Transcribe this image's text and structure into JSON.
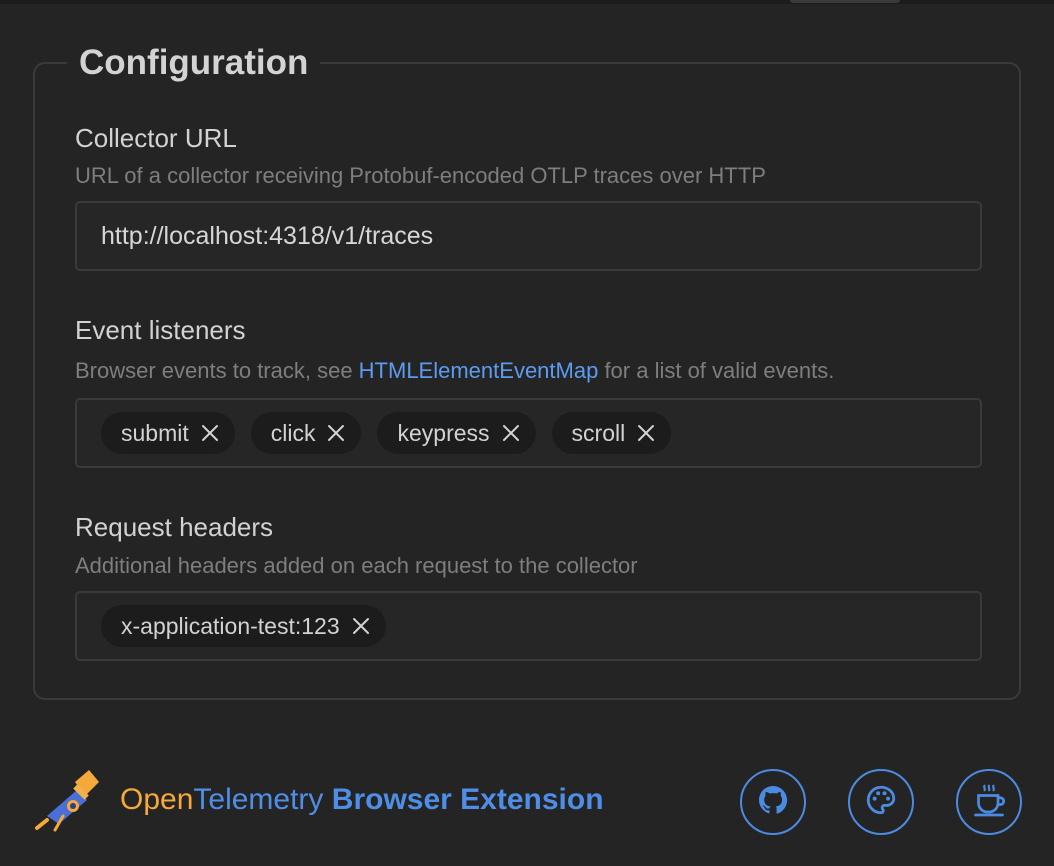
{
  "config": {
    "legend": "Configuration",
    "collector": {
      "label": "Collector URL",
      "description": "URL of a collector receiving Protobuf-encoded OTLP traces over HTTP",
      "value": "http://localhost:4318/v1/traces"
    },
    "events": {
      "label": "Event listeners",
      "description_before": "Browser events to track, see ",
      "description_link": "HTMLElementEventMap",
      "description_after": " for a list of valid events.",
      "chips": [
        "submit",
        "click",
        "keypress",
        "scroll"
      ]
    },
    "headers": {
      "label": "Request headers",
      "description": "Additional headers added on each request to the collector",
      "chips": [
        "x-application-test:123"
      ]
    }
  },
  "footer": {
    "title_open": "Open",
    "title_telemetry": "Telemetry",
    "title_extension": "Browser Extension",
    "buttons": [
      {
        "icon": "github-icon"
      },
      {
        "icon": "palette-icon"
      },
      {
        "icon": "coffee-icon"
      }
    ]
  },
  "colors": {
    "background": "#242424",
    "accent_blue": "#4f8ee6",
    "accent_orange": "#f5a93a",
    "link": "#5c9cf0"
  }
}
